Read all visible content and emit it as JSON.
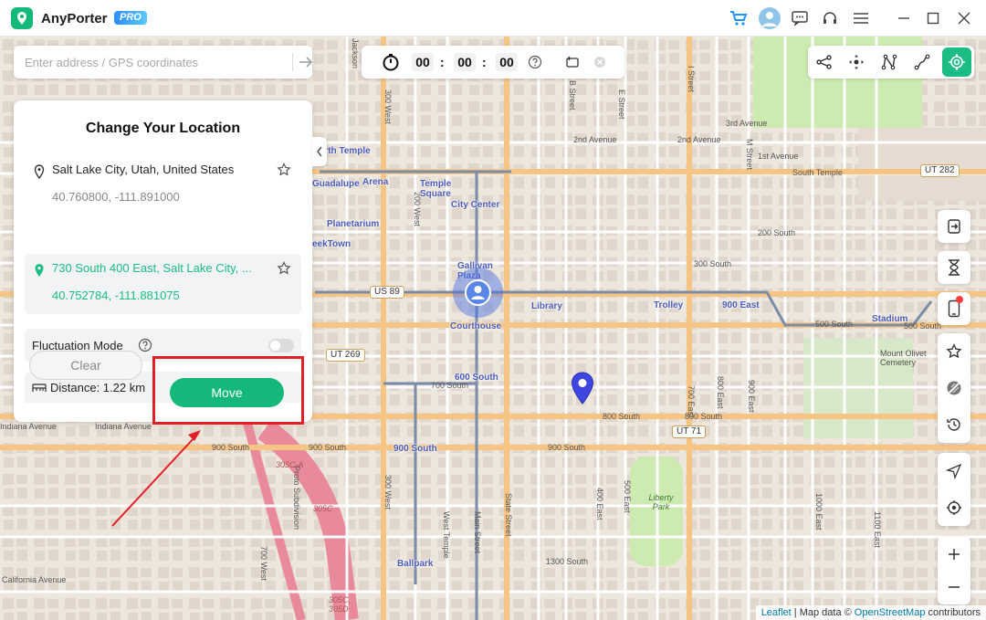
{
  "app": {
    "name": "AnyPorter",
    "badge": "PRO"
  },
  "titlebar_icons": [
    "cart-icon",
    "avatar",
    "chat-icon",
    "headset-icon",
    "menu-icon",
    "minimize-icon",
    "maximize-icon",
    "close-icon"
  ],
  "search": {
    "placeholder": "Enter address / GPS coordinates",
    "value": ""
  },
  "timer": {
    "hours": "00",
    "minutes": "00",
    "seconds": "00",
    "separator": ":"
  },
  "modes": {
    "icons": [
      "jump-teleport-icon",
      "joystick-icon",
      "multi-spot-icon",
      "two-spot-icon",
      "teleport-mode-icon"
    ],
    "active": "teleport-mode-icon",
    "accent_color": "#1bbd83"
  },
  "panel": {
    "title": "Change Your Location",
    "origin": {
      "name": "Salt Lake City, Utah, United States",
      "coords": "40.760800, -111.891000"
    },
    "destination": {
      "name": "730 South 400 East, Salt Lake City, ...",
      "coords": "40.752784, -111.881075"
    },
    "fluctuation_label": "Fluctuation Mode",
    "fluctuation_on": false,
    "distance_label": "Distance: 1.22 km",
    "clear_label": "Clear",
    "move_label": "Move"
  },
  "map": {
    "streets_h": [
      "3rd Avenue",
      "2nd Avenue",
      "2nd Avenue",
      "1st Avenue",
      "South Temple",
      "200 South",
      "300 South",
      "700 South",
      "800 South",
      "800 South",
      "900 South",
      "900 South",
      "900 South",
      "1300 South",
      "Indiana Avenue",
      "Indiana Avenue",
      "California Avenue",
      "500 South",
      "500 South"
    ],
    "streets_v": [
      "300 West",
      "200 West",
      "300 West",
      "700 West",
      "West Temple",
      "Main Street",
      "State Street",
      "400 East",
      "500 East",
      "700 East",
      "800 East",
      "900 East",
      "1000 East",
      "1100 East",
      "M Street",
      "I Street",
      "E Street",
      "B Street",
      "Jackson"
    ],
    "stations": [
      "Arena",
      "Temple Square",
      "City Center",
      "Planetarium",
      "Gallivan Plaza",
      "Library",
      "Trolley",
      "900 East",
      "Courthouse",
      "600 South",
      "900 South",
      "Ballpark",
      "Stadium",
      "North Temple",
      "Guadalupe",
      "eekTown"
    ],
    "shields": [
      "US 89",
      "UT 269",
      "UT 71",
      "UT 282"
    ],
    "places": [
      "Liberty Park",
      "Mount Olivet Cemetery",
      "Proto Subdivision",
      "305C-A",
      "305C",
      "305C, 305D"
    ],
    "attribution": {
      "leaflet": "Leaflet",
      "text": "| Map data ©",
      "osm": "OpenStreetMap",
      "suffix": "contributors"
    }
  },
  "side_tools": [
    "import-icon",
    "hourglass-icon",
    "device-icon",
    "favorite-icon",
    "route-block-icon",
    "history-icon",
    "navigate-icon",
    "locate-icon",
    "zoom-in-icon",
    "zoom-out-icon"
  ],
  "colors": {
    "brand": "#14b87a",
    "highlight": "#e21f26",
    "marker": "#3f46e0"
  }
}
